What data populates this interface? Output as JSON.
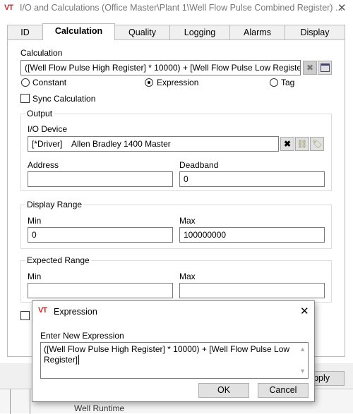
{
  "window": {
    "logo": "VT",
    "title": "I/O and Calculations (Office Master\\Plant 1\\Well Flow Pulse Combined Register) ...",
    "close": "✕"
  },
  "tabs": [
    {
      "label": "ID"
    },
    {
      "label": "Calculation"
    },
    {
      "label": "Quality"
    },
    {
      "label": "Logging"
    },
    {
      "label": "Alarms"
    },
    {
      "label": "Display"
    }
  ],
  "calculation": {
    "label": "Calculation",
    "value": "([Well Flow Pulse High Register] * 10000) + [Well Flow Pulse Low Register]",
    "clear": "✖",
    "options": [
      {
        "label": "Constant",
        "selected": false
      },
      {
        "label": "Expression",
        "selected": true
      },
      {
        "label": "Tag",
        "selected": false
      }
    ],
    "sync_label": "Sync Calculation",
    "sync_checked": false
  },
  "output": {
    "label": "Output",
    "io_device_label": "I/O Device",
    "io_device_value": "[*Driver]    Allen Bradley 1400 Master",
    "clear": "✖",
    "address_label": "Address",
    "address_value": "",
    "deadband_label": "Deadband",
    "deadband_value": "0"
  },
  "display_range": {
    "label": "Display Range",
    "min_label": "Min",
    "min_value": "0",
    "max_label": "Max",
    "max_value": "100000000"
  },
  "expected_range": {
    "label": "Expected Range",
    "min_label": "Min",
    "min_value": "",
    "max_label": "Max",
    "max_value": ""
  },
  "apply_label": "pply",
  "background_tree_item": "Well Runtime",
  "dialog": {
    "logo": "VT",
    "title": "Expression",
    "close": "✕",
    "prompt": "Enter New Expression",
    "value": "([Well Flow Pulse High Register] * 10000) + [Well Flow Pulse Low Register]",
    "ok": "OK",
    "cancel": "Cancel"
  }
}
